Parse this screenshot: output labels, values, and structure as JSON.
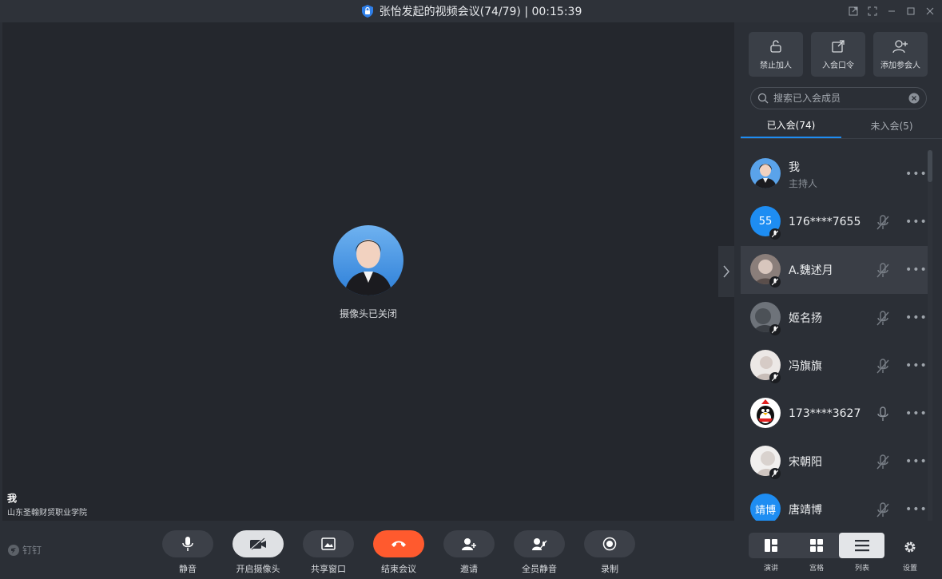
{
  "window": {
    "title": "张怡发起的视频会议(74/79) | 00:15:39"
  },
  "stage": {
    "camera_status": "摄像头已关闭",
    "self_name": "我",
    "self_org": "山东圣翰财贸职业学院"
  },
  "panel": {
    "buttons": [
      {
        "label": "禁止加人",
        "icon": "lock-open-icon"
      },
      {
        "label": "入会口令",
        "icon": "external-link-icon"
      },
      {
        "label": "添加参会人",
        "icon": "add-user-icon"
      }
    ],
    "search": {
      "placeholder": "搜索已入会成员"
    },
    "tabs": [
      {
        "label": "已入会(74)",
        "active": true
      },
      {
        "label": "未入会(5)",
        "active": false
      }
    ],
    "members": [
      {
        "name": "我",
        "role": "主持人",
        "avatar": "photo",
        "muted": null
      },
      {
        "name": "176****7655",
        "avatar_text": "55",
        "avatar": "text",
        "muted": true
      },
      {
        "name": "A.魏述月",
        "avatar": "photo",
        "muted": true
      },
      {
        "name": "姬名扬",
        "avatar": "photo",
        "muted": true
      },
      {
        "name": "冯旗旗",
        "avatar": "photo",
        "muted": true
      },
      {
        "name": "173****3627",
        "avatar": "qq",
        "muted": false
      },
      {
        "name": "宋朝阳",
        "avatar": "photo",
        "muted": true
      },
      {
        "name": "唐靖博",
        "avatar_text": "靖博",
        "avatar": "text",
        "muted": true
      }
    ]
  },
  "toolbar": {
    "logo": "钉钉",
    "buttons": [
      {
        "label": "静音",
        "icon": "microphone-icon"
      },
      {
        "label": "开启摄像头",
        "icon": "camera-off-icon"
      },
      {
        "label": "共享窗口",
        "icon": "share-screen-icon"
      },
      {
        "label": "结束会议",
        "icon": "hang-up-icon"
      },
      {
        "label": "邀请",
        "icon": "invite-icon"
      },
      {
        "label": "全员静音",
        "icon": "mute-all-icon"
      },
      {
        "label": "录制",
        "icon": "record-icon"
      }
    ],
    "views": [
      {
        "label": "演讲",
        "icon": "speaker-layout-icon"
      },
      {
        "label": "宫格",
        "icon": "grid-layout-icon"
      },
      {
        "label": "列表",
        "icon": "list-layout-icon",
        "active": true
      }
    ],
    "settings_label": "设置"
  },
  "colors": {
    "accent": "#1e8df2",
    "end_call": "#ff5a2e",
    "background": "#24272d"
  }
}
